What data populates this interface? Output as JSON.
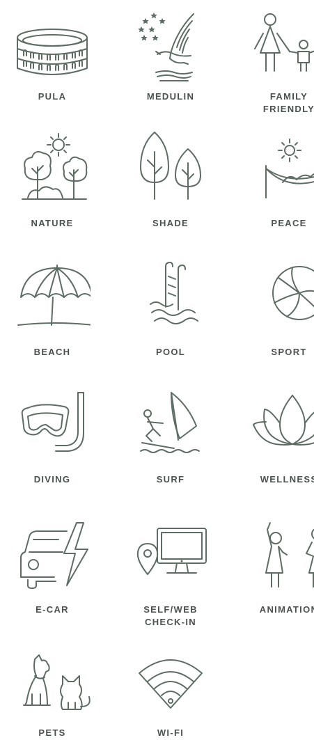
{
  "colors": {
    "icon": "#5d6d63",
    "label": "#4a524d",
    "background": "#ffffff"
  },
  "amenities": [
    {
      "label": "PULA",
      "icon": "colosseum-icon"
    },
    {
      "label": "MEDULIN",
      "icon": "eagle-stars-icon"
    },
    {
      "label_line1": "FAMILY",
      "label_line2": "FRIENDLY",
      "icon": "family-icon"
    },
    {
      "label": "NATURE",
      "icon": "trees-sun-icon"
    },
    {
      "label": "SHADE",
      "icon": "two-trees-icon"
    },
    {
      "label": "PEACE",
      "icon": "hammock-icon"
    },
    {
      "label": "BEACH",
      "icon": "parasol-icon"
    },
    {
      "label": "POOL",
      "icon": "pool-ladder-icon"
    },
    {
      "label": "SPORT",
      "icon": "volleyball-icon"
    },
    {
      "label": "DIVING",
      "icon": "snorkel-mask-icon"
    },
    {
      "label": "SURF",
      "icon": "windsurf-icon"
    },
    {
      "label": "WELLNESS",
      "icon": "lotus-icon"
    },
    {
      "label": "E-CAR",
      "icon": "electric-car-icon"
    },
    {
      "label_line1": "SELF/WEB",
      "label_line2": "CHECK-IN",
      "icon": "web-checkin-icon"
    },
    {
      "label": "ANIMATION",
      "icon": "dancing-kids-icon"
    },
    {
      "label": "PETS",
      "icon": "pets-icon"
    },
    {
      "label": "WI-FI",
      "icon": "wifi-icon"
    }
  ]
}
